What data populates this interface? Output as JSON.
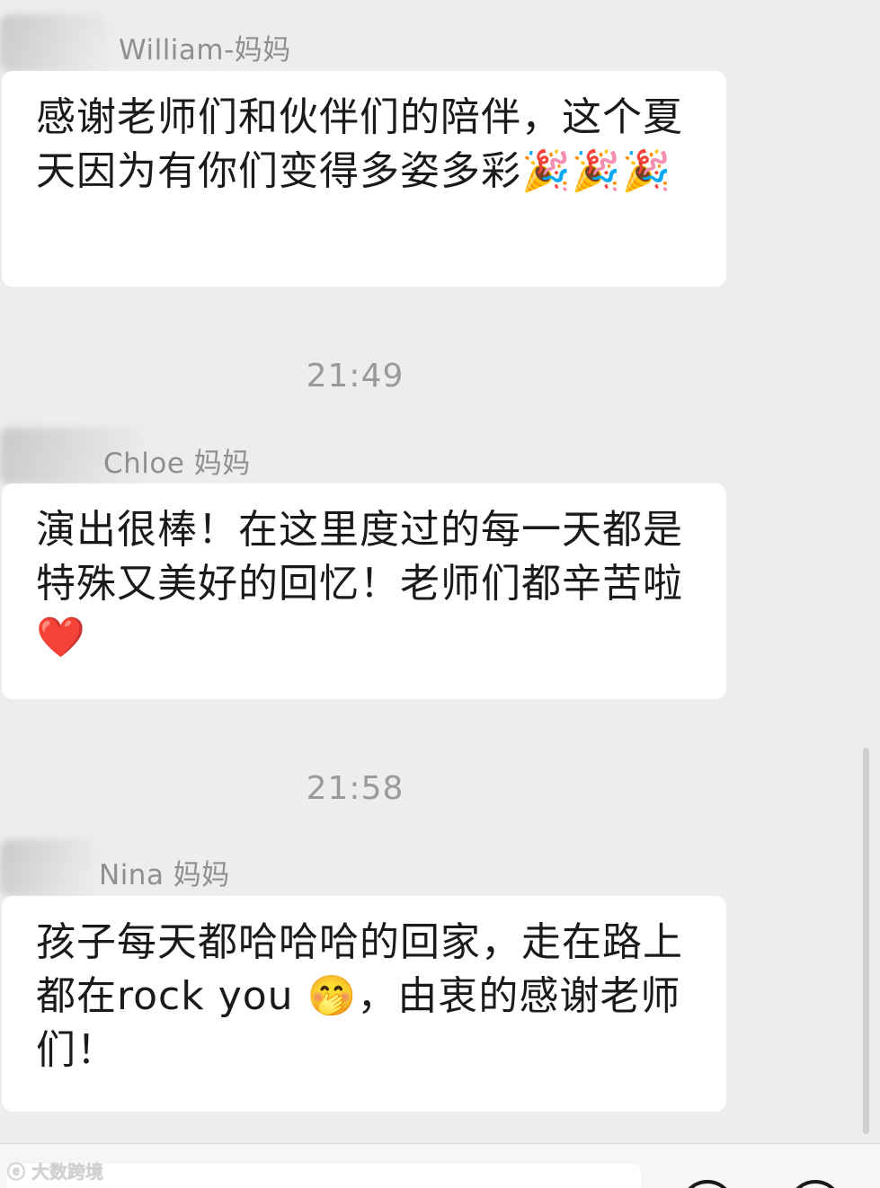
{
  "messages": [
    {
      "sender": "William-妈妈",
      "text": "感谢老师们和伙伴们的陪伴，这个夏天因为有你们变得多姿多彩🎉🎉🎉"
    },
    {
      "timestamp": "21:49",
      "sender": "Chloe 妈妈",
      "text": "演出很棒！在这里度过的每一天都是特殊又美好的回忆！老师们都辛苦啦❤️"
    },
    {
      "timestamp": "21:58",
      "sender": "Nina 妈妈",
      "text": "孩子每天都哈哈哈的回家，走在路上都在rock you 🤭，由衷的感谢老师们！"
    }
  ],
  "watermark": "大数跨境",
  "icons": {
    "voice": "voice-icon",
    "emoji": "emoji-icon"
  }
}
